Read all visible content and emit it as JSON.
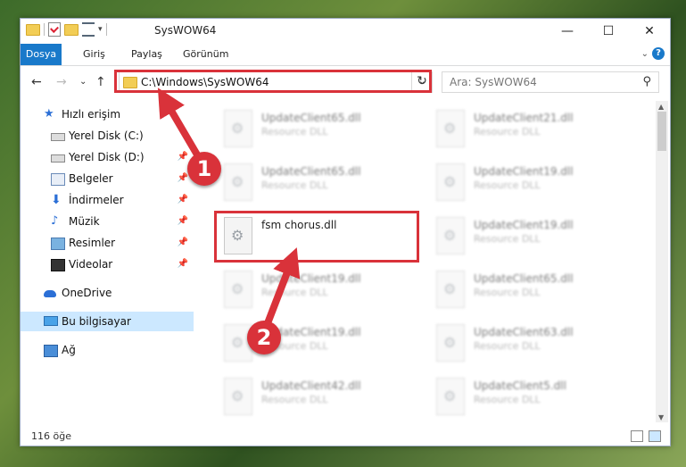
{
  "window": {
    "title": "SysWOW64"
  },
  "titlebar": {
    "minimize": "—",
    "maximize": "☐",
    "close": "✕"
  },
  "ribbon": {
    "tabs": [
      "Dosya",
      "Giriş",
      "Paylaş",
      "Görünüm"
    ],
    "help": "?"
  },
  "address": {
    "path": "C:\\Windows\\SysWOW64"
  },
  "search": {
    "placeholder": "Ara: SysWOW64"
  },
  "sidebar": {
    "items": [
      {
        "label": "Hızlı erişim",
        "icon": "star-icon"
      },
      {
        "label": "Yerel Disk (C:)",
        "icon": "disk-icon"
      },
      {
        "label": "Yerel Disk (D:)",
        "icon": "disk-icon"
      },
      {
        "label": "Belgeler",
        "icon": "documents-icon"
      },
      {
        "label": "İndirmeler",
        "icon": "download-icon"
      },
      {
        "label": "Müzik",
        "icon": "music-icon"
      },
      {
        "label": "Resimler",
        "icon": "pictures-icon"
      },
      {
        "label": "Videolar",
        "icon": "videos-icon"
      },
      {
        "label": "OneDrive",
        "icon": "cloud-icon"
      },
      {
        "label": "Bu bilgisayar",
        "icon": "computer-icon"
      },
      {
        "label": "Ağ",
        "icon": "network-icon"
      }
    ]
  },
  "files": {
    "left": [
      {
        "name": "UpdateClient65.dll",
        "type": "Resource DLL"
      },
      {
        "name": "UpdateClient65.dll",
        "type": "Resource DLL"
      },
      {
        "name": "fsm chorus.dll",
        "type": ""
      },
      {
        "name": "UpdateClient19.dll",
        "type": "Resource DLL"
      },
      {
        "name": "UpdateClient19.dll",
        "type": "Resource DLL"
      },
      {
        "name": "UpdateClient42.dll",
        "type": "Resource DLL"
      },
      {
        "name": "",
        "type": ""
      }
    ],
    "right": [
      {
        "name": "UpdateClient21.dll",
        "type": "Resource DLL"
      },
      {
        "name": "UpdateClient19.dll",
        "type": "Resource DLL"
      },
      {
        "name": "UpdateClient19.dll",
        "type": "Resource DLL"
      },
      {
        "name": "UpdateClient65.dll",
        "type": "Resource DLL"
      },
      {
        "name": "UpdateClient63.dll",
        "type": "Resource DLL"
      },
      {
        "name": "UpdateClient5.dll",
        "type": "Resource DLL"
      },
      {
        "name": "",
        "type": ""
      }
    ]
  },
  "status": {
    "count": "116 öğe"
  },
  "annotations": {
    "step1": "1",
    "step2": "2",
    "color": "#d9323a"
  }
}
